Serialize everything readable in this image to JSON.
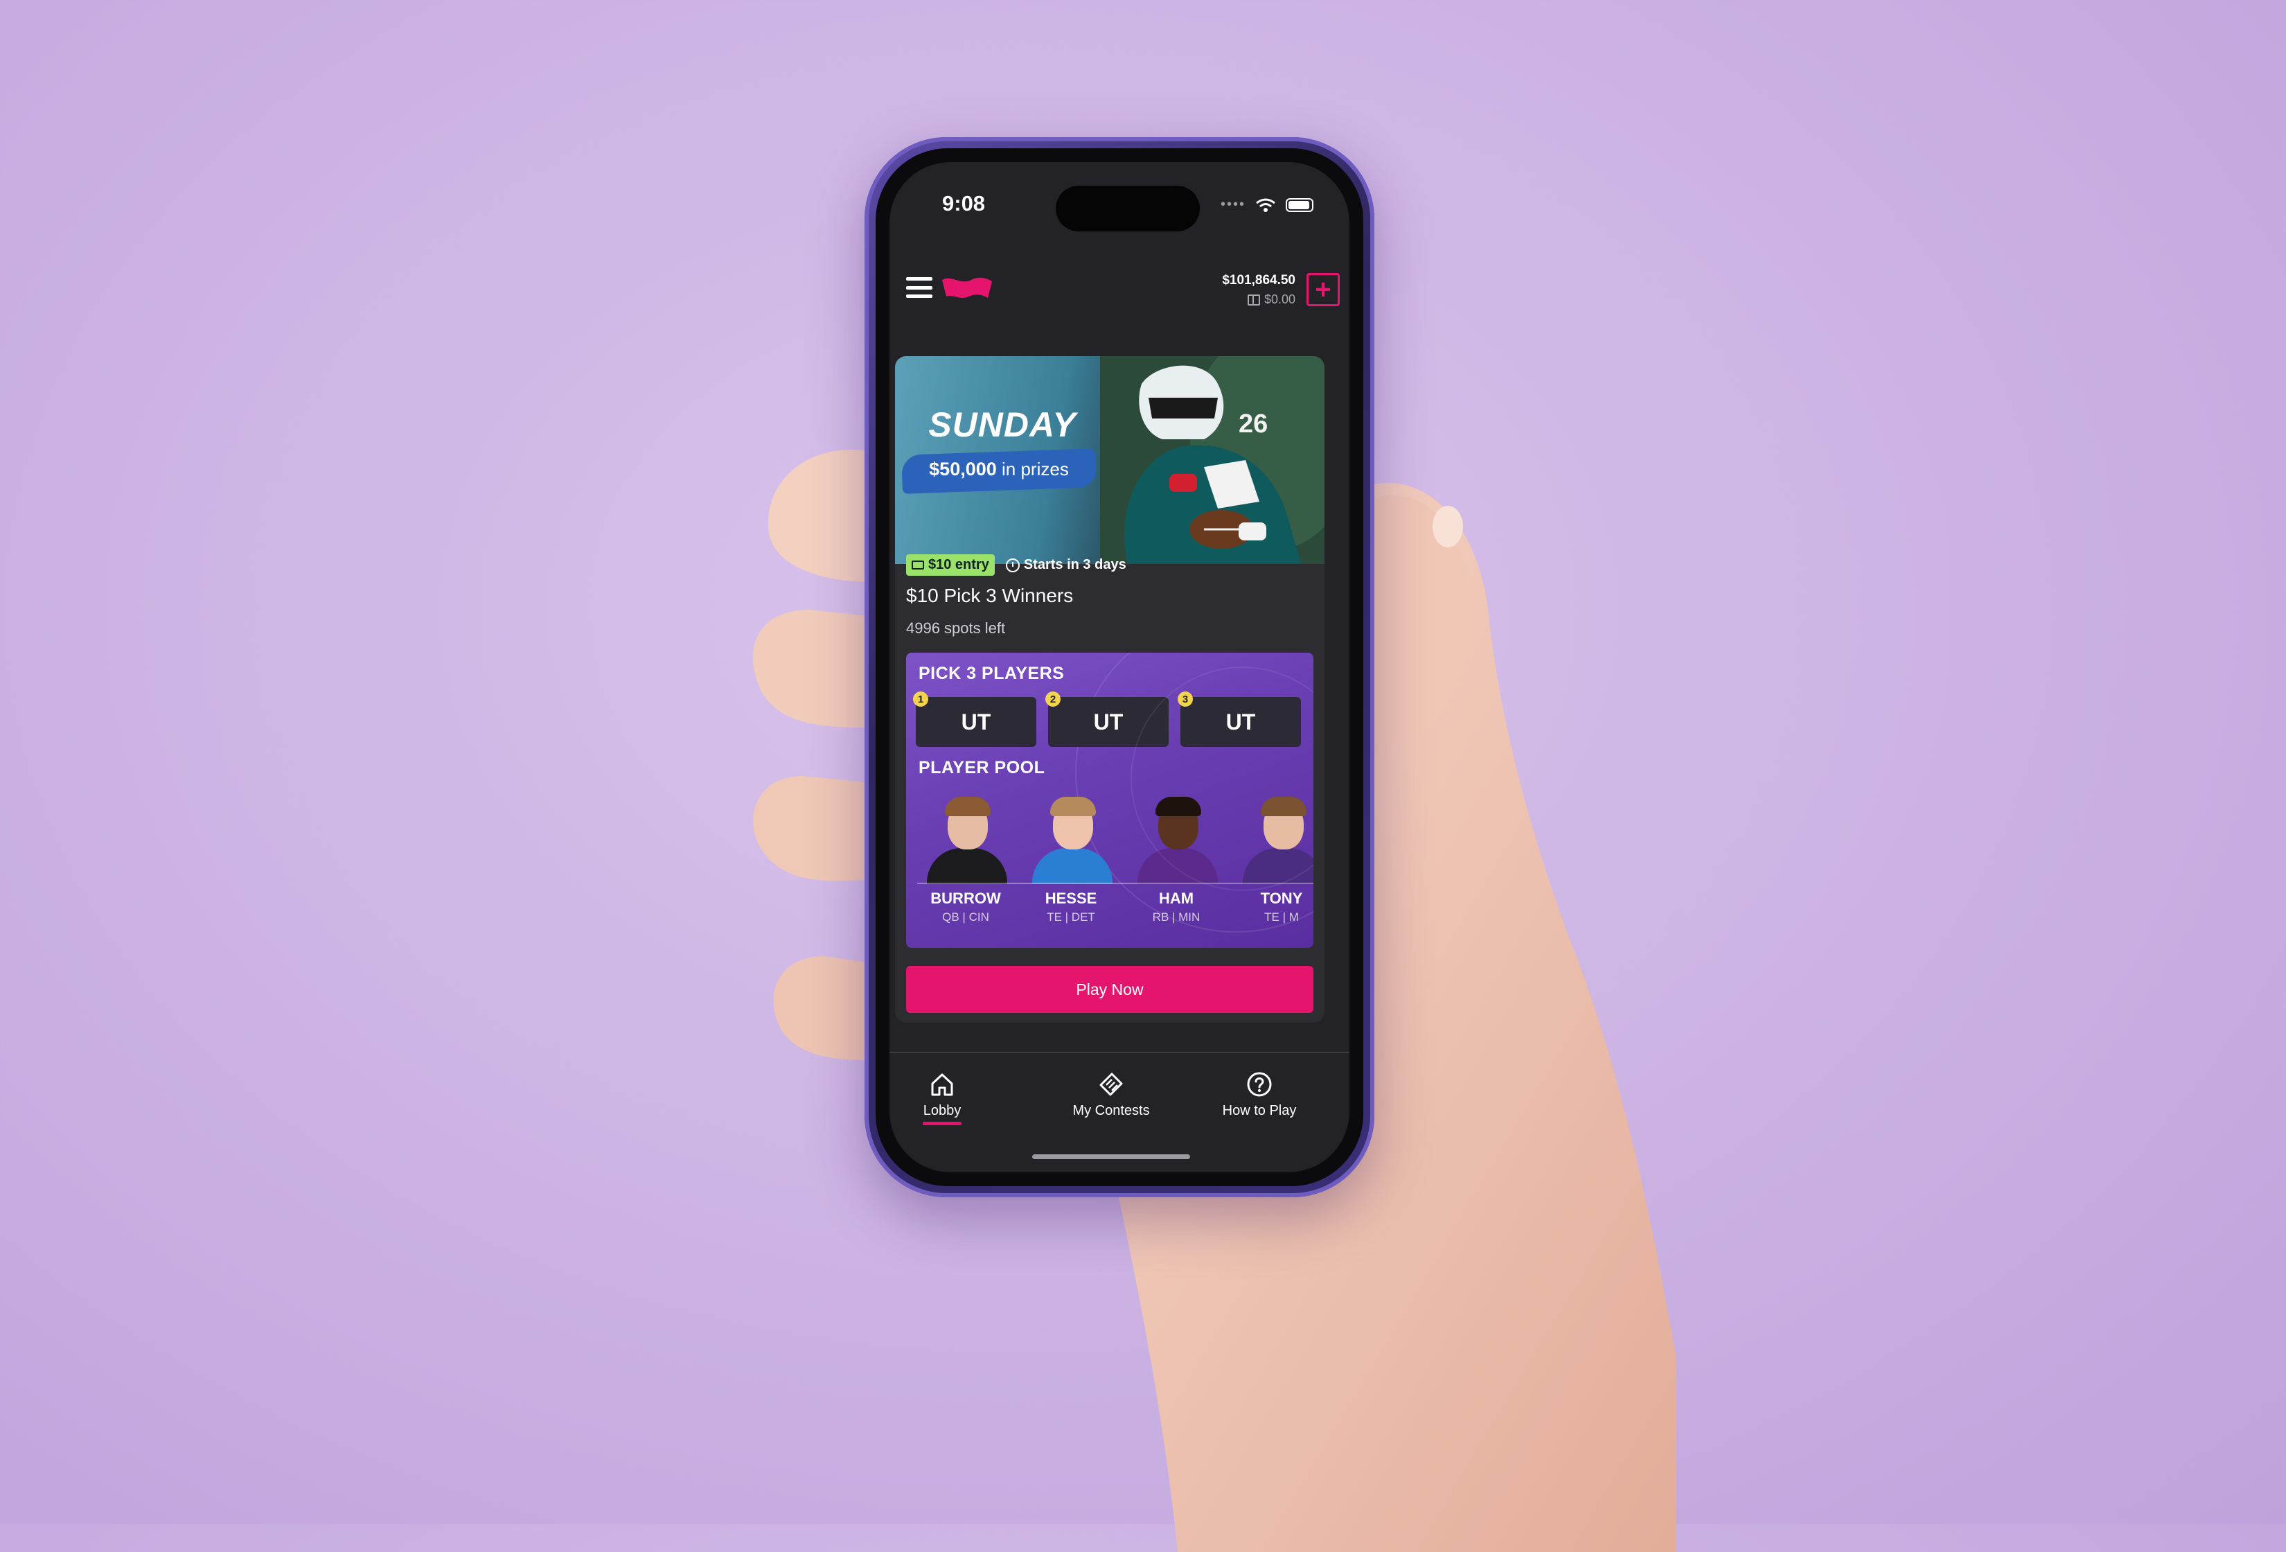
{
  "status_bar": {
    "time": "9:08"
  },
  "header": {
    "cash_balance": "$101,864.50",
    "bonus_balance": "$0.00",
    "icons": [
      "menu-icon",
      "flag-logo",
      "gift-icon",
      "plus-icon"
    ]
  },
  "banner": {
    "title": "SUNDAY",
    "prize_amount": "$50,000",
    "prize_suffix": "in prizes"
  },
  "contest": {
    "entry_badge": "$10 entry",
    "starts_label": "Starts in 3 days",
    "title": "$10 Pick 3 Winners",
    "spots_left": "4996 spots left"
  },
  "pick_panel": {
    "heading": "PICK 3 PLAYERS",
    "slots": [
      {
        "number": "1",
        "label": "UT"
      },
      {
        "number": "2",
        "label": "UT"
      },
      {
        "number": "3",
        "label": "UT"
      }
    ],
    "pool_heading": "PLAYER POOL",
    "players": [
      {
        "name": "BURROW",
        "position": "QB | CIN"
      },
      {
        "name": "HESSE",
        "position": "TE | DET"
      },
      {
        "name": "HAM",
        "position": "RB | MIN"
      },
      {
        "name": "TONY",
        "position": "TE | M"
      }
    ]
  },
  "cta": {
    "label": "Play Now"
  },
  "bottom_nav": [
    {
      "label": "Lobby",
      "icon": "home-icon",
      "active": true
    },
    {
      "label": "My Contests",
      "icon": "ticket-icon",
      "active": false
    },
    {
      "label": "How to Play",
      "icon": "help-icon",
      "active": false
    }
  ],
  "colors": {
    "accent": "#e5156e",
    "entry_green": "#9be26a",
    "panel_purple": "#6a3fb3",
    "screen_bg": "#232226"
  }
}
